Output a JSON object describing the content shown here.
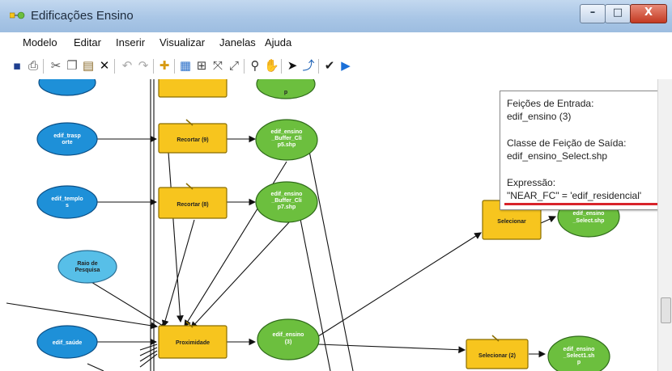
{
  "window": {
    "title": "Edificações Ensino",
    "minimize": "–",
    "maximize": "□",
    "close": "X"
  },
  "menu": [
    "Modelo",
    "Editar",
    "Inserir",
    "Visualizar",
    "Janelas",
    "Ajuda"
  ],
  "toolbar_icons": [
    "save-icon",
    "print-icon",
    "cut-icon",
    "copy-icon",
    "paste-icon",
    "delete-icon",
    "undo-icon",
    "redo-icon",
    "add-data-icon",
    "auto-layout-icon",
    "full-extent-icon",
    "zoom-extent-icon",
    "zoom-in-icon",
    "pan-icon",
    "select-icon",
    "connect-icon",
    "validate-icon",
    "run-icon"
  ],
  "nodes": {
    "edif_transporte": [
      "edif_trasp",
      "orte"
    ],
    "edif_templo": [
      "edif_templo",
      "s"
    ],
    "raio_pesquisa": [
      "Raio de",
      "Pesquisa"
    ],
    "edif_saude": [
      "edif_saúde"
    ],
    "recortar_9": [
      "Recortar (9)"
    ],
    "recortar_8": [
      "Recortar (8)"
    ],
    "proximidade": [
      "Proximidade"
    ],
    "top_green": [
      "p"
    ],
    "buffer_clip5": [
      "edif_ensino",
      "_Buffer_Cli",
      "p5.shp"
    ],
    "buffer_clip7": [
      "edif_ensino",
      "_Buffer_Cli",
      "p7.shp"
    ],
    "edif_ensino_3": [
      "edif_ensino",
      "(3)"
    ],
    "selecionar": [
      "Selecionar"
    ],
    "select_shp": [
      "edif_ensino",
      "_Select.shp"
    ],
    "selecionar_2": [
      "Selecionar (2)"
    ],
    "select1_shp": [
      "edif_ensino",
      "_Select1.sh",
      "p"
    ]
  },
  "tooltip": {
    "input_label": "Feições de Entrada:",
    "input_value": "edif_ensino (3)",
    "output_label": "Classe de Feição de Saída:",
    "output_value": "edif_ensino_Select.shp",
    "expr_label": "Expressão:",
    "expr_value": "\"NEAR_FC\" = 'edif_residencial'"
  },
  "colors": {
    "input_blue": "#1e90d8",
    "param_blue": "#57bfe8",
    "tool_yellow": "#f7c51e",
    "output_green": "#6cbf3e",
    "highlight_red": "#d8232a"
  }
}
